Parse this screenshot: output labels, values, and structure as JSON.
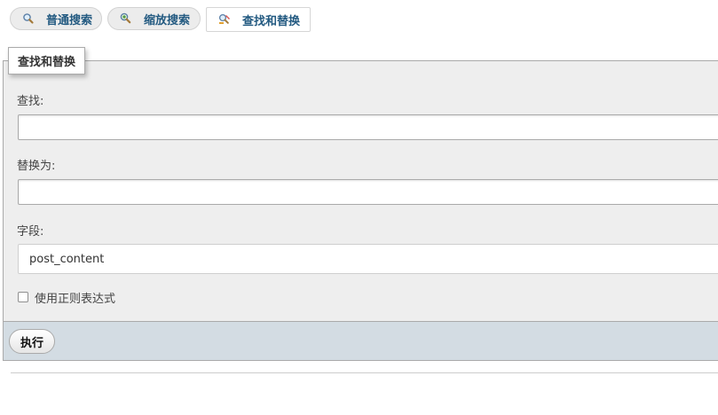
{
  "tabs": [
    {
      "label": "普通搜索",
      "icon": "search-icon",
      "active": false
    },
    {
      "label": "缩放搜索",
      "icon": "zoom-search-icon",
      "active": false
    },
    {
      "label": "查找和替换",
      "icon": "find-replace-icon",
      "active": true
    }
  ],
  "panel": {
    "legend": "查找和替换",
    "find_label": "查找:",
    "find_value": "",
    "replace_label": "替换为:",
    "replace_value": "",
    "column_label": "字段:",
    "column_value": "post_content",
    "regex_label": "使用正则表达式",
    "regex_checked": false
  },
  "footer": {
    "go_label": "执行"
  },
  "colors": {
    "tab_text": "#235a81",
    "panel_bg": "#eeeeee",
    "footer_bg": "#d3dce3",
    "border": "#aaaaaa"
  }
}
